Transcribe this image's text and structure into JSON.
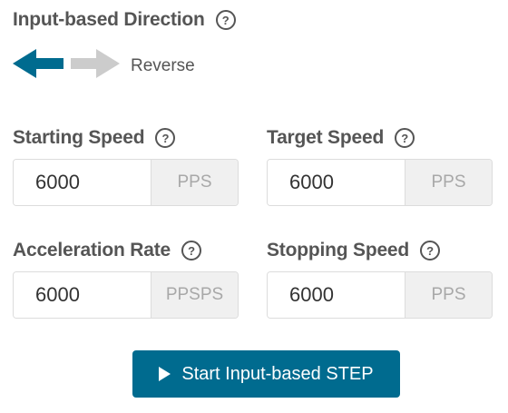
{
  "direction": {
    "label": "Input-based Direction",
    "help_icon": "question-circle-icon",
    "help_glyph": "?",
    "selected": "reverse",
    "reverse_arrow_color": "#006b8f",
    "forward_arrow_color": "#cccccc",
    "state_text": "Reverse"
  },
  "fields": {
    "starting_speed": {
      "label": "Starting Speed",
      "value": "6000",
      "unit": "PPS",
      "help_glyph": "?"
    },
    "target_speed": {
      "label": "Target Speed",
      "value": "6000",
      "unit": "PPS",
      "help_glyph": "?"
    },
    "acceleration_rate": {
      "label": "Acceleration Rate",
      "value": "6000",
      "unit": "PPSPS",
      "help_glyph": "?"
    },
    "stopping_speed": {
      "label": "Stopping Speed",
      "value": "6000",
      "unit": "PPS",
      "help_glyph": "?"
    }
  },
  "start_button": {
    "label": "Start Input-based STEP",
    "icon": "play-icon",
    "color": "#006b8f"
  }
}
